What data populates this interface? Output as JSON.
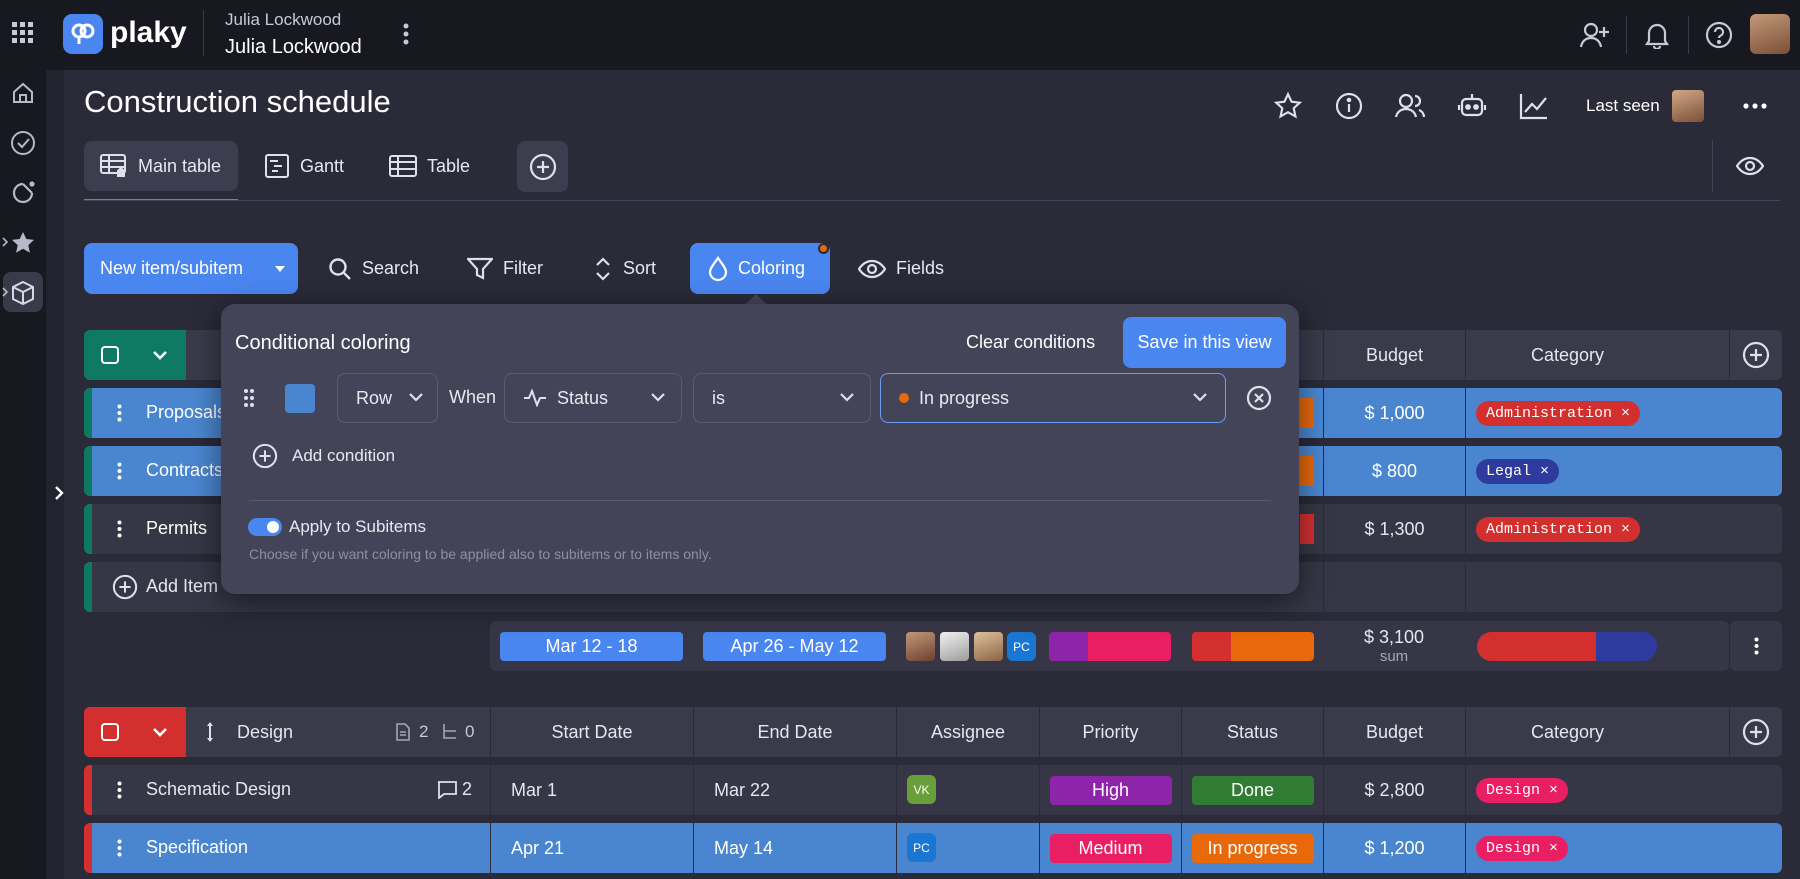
{
  "topbar": {
    "brand": "plaky",
    "workspace_top": "Julia Lockwood",
    "workspace_bottom": "Julia Lockwood"
  },
  "page": {
    "title": "Construction schedule",
    "last_seen_label": "Last seen"
  },
  "views": {
    "main_table": "Main table",
    "gantt": "Gantt",
    "table": "Table"
  },
  "toolbar": {
    "new_item": "New item/subitem",
    "search": "Search",
    "filter": "Filter",
    "sort": "Sort",
    "coloring": "Coloring",
    "fields": "Fields"
  },
  "popup": {
    "title": "Conditional coloring",
    "clear": "Clear conditions",
    "save": "Save in this view",
    "row_select": "Row",
    "when": "When",
    "field_select": "Status",
    "operator_select": "is",
    "value_select": "In progress",
    "add_condition": "Add condition",
    "apply_subitems": "Apply to Subitems",
    "apply_hint": "Choose if you want coloring to be applied also to subitems or to items only.",
    "swatch_color": "#4a86d0"
  },
  "group1": {
    "header": {
      "budget": "Budget",
      "category": "Category"
    },
    "rows": [
      {
        "name": "Proposals",
        "budget": "$ 1,000",
        "category": "Administration ×"
      },
      {
        "name": "Contracts",
        "budget": "$ 800",
        "category": "Legal ×"
      },
      {
        "name": "Permits",
        "budget": "$ 1,300",
        "category": "Administration ×"
      }
    ],
    "add_item": "Add Item",
    "summary": {
      "start": "Mar 12 - 18",
      "end": "Apr 26 - May 12",
      "assignee_chip": "PC",
      "budget": "$ 3,100",
      "budget_sub": "sum"
    }
  },
  "group2": {
    "header": {
      "name": "Design",
      "docs": "2",
      "subs": "0",
      "start": "Start Date",
      "end": "End Date",
      "assignee": "Assignee",
      "priority": "Priority",
      "status": "Status",
      "budget": "Budget",
      "category": "Category"
    },
    "rows": [
      {
        "name": "Schematic Design",
        "comments": "2",
        "start": "Mar 1",
        "end": "Mar 22",
        "assignee": "VK",
        "priority": "High",
        "status": "Done",
        "budget": "$ 2,800",
        "category": "Design ×"
      },
      {
        "name": "Specification",
        "start": "Apr 21",
        "end": "May 14",
        "assignee": "PC",
        "priority": "Medium",
        "status": "In progress",
        "budget": "$ 1,200",
        "category": "Design ×"
      }
    ]
  },
  "colors": {
    "accent": "#4a86f0",
    "green_group": "#0e7a64",
    "red_group": "#d32f2f",
    "admin_tag": "#d32f2f",
    "legal_tag": "#2f3a9e",
    "design_tag": "#e91e63",
    "high": "#8e24aa",
    "medium": "#e91e63",
    "done": "#2e7d32",
    "in_progress": "#e8680a"
  }
}
